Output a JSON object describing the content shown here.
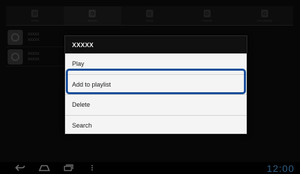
{
  "tabs": [
    {
      "label": "Artists",
      "icon": "artist-icon",
      "active": false
    },
    {
      "label": "Albums",
      "icon": "album-icon",
      "active": true
    },
    {
      "label": "Songs",
      "icon": "song-icon",
      "active": false
    },
    {
      "label": "Playlists",
      "icon": "playlist-icon",
      "active": false
    },
    {
      "label": "Now playing",
      "icon": "now-playing-icon",
      "active": false
    }
  ],
  "background_list": [
    {
      "title": "XXXXX",
      "subtitle": "XXXXX"
    },
    {
      "title": "XXXXX",
      "subtitle": "XXXXX"
    }
  ],
  "dialog": {
    "title": "XXXXX",
    "items": [
      {
        "label": "Play"
      },
      {
        "label": "Add to playlist",
        "highlighted": true
      },
      {
        "label": "Delete"
      },
      {
        "label": "Search"
      }
    ]
  },
  "status": {
    "time": "12:00"
  },
  "colors": {
    "highlight": "#1a4f9a",
    "clock": "#2f5f86"
  }
}
